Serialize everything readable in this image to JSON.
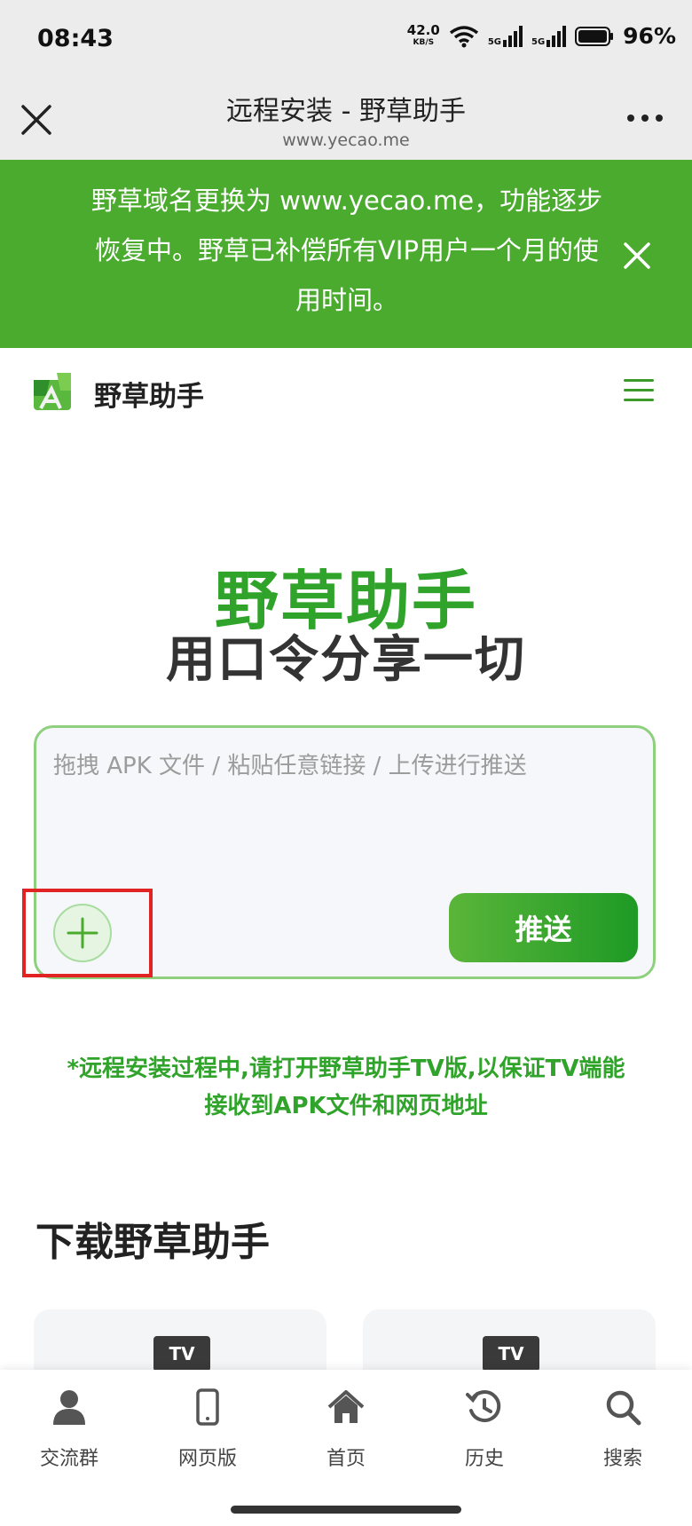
{
  "status_bar": {
    "time": "08:43",
    "net_speed": "42.0",
    "net_speed_unit": "KB/S",
    "signal_1_label": "5G",
    "signal_2_label": "5G",
    "battery": "96%"
  },
  "browser": {
    "title": "远程安装 - 野草助手",
    "url": "www.yecao.me"
  },
  "notice": {
    "text": "野草域名更换为 www.yecao.me，功能逐步恢复中。野草已补偿所有VIP用户一个月的使用时间。"
  },
  "header": {
    "site_name": "野草助手"
  },
  "hero": {
    "title": "野草助手",
    "subtitle": "用口令分享一切"
  },
  "push_box": {
    "placeholder": "拖拽 APK 文件 / 粘贴任意链接 / 上传进行推送",
    "push_label": "推送"
  },
  "hint": {
    "line1": "*远程安装过程中,请打开野草助手TV版,以保证TV端能",
    "line2": "接收到APK文件和网页地址"
  },
  "download": {
    "heading": "下载野草助手",
    "cards": [
      {
        "badge": "TV"
      },
      {
        "badge": "TV"
      }
    ]
  },
  "bottom_nav": {
    "items": [
      {
        "label": "交流群",
        "icon": "user-icon"
      },
      {
        "label": "网页版",
        "icon": "phone-icon"
      },
      {
        "label": "首页",
        "icon": "home-icon"
      },
      {
        "label": "历史",
        "icon": "history-icon"
      },
      {
        "label": "搜索",
        "icon": "search-icon"
      }
    ]
  },
  "colors": {
    "brand_green": "#2fa32a",
    "notice_green": "#4aab2f",
    "highlight_red": "#e12323"
  }
}
